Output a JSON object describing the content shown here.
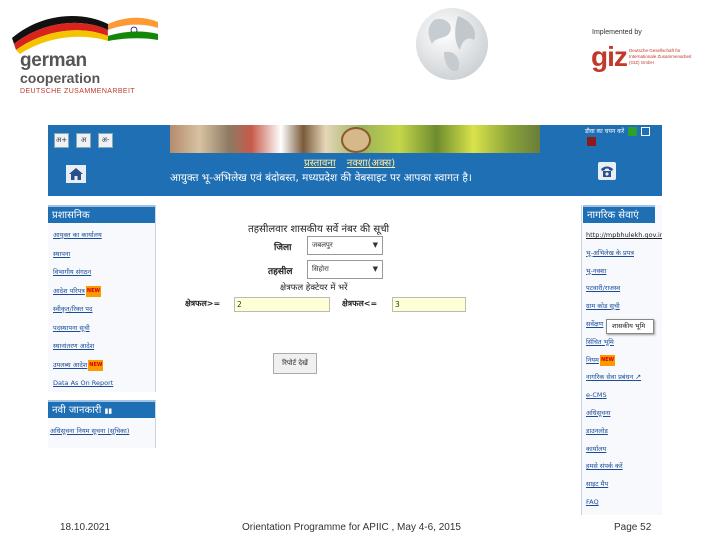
{
  "slide": {
    "logo": {
      "line1": "german",
      "line2": "cooperation",
      "line3": "DEUTSCHE ZUSAMMENARBEIT"
    },
    "implemented_by": "Implemented by",
    "giz": {
      "word": "giz",
      "sub": "Deutsche Gesellschaft für Internationale Zusammenarbeit (GIZ) GmbH"
    },
    "footer": {
      "date": "18.10.2021",
      "title": "Orientation Programme for APIIC , May 4-6, 2015",
      "page": "Page 52"
    }
  },
  "portal": {
    "lang_buttons": [
      "अ+",
      "अ",
      "अ-"
    ],
    "top_links": [
      "प्रस्तावना",
      "नक्शा(अक्स)"
    ],
    "welcome": "आयुक्त भू-अभिलेख एवं बंदोबस्त, मध्यप्रदेश की वेबसाइट पर आपका स्वागत है।",
    "size_label": "डीवा का चयन करें",
    "left_panel": {
      "title": "प्रशासनिक",
      "items": [
        {
          "label": "आयुक्त का कार्यालय",
          "badge": ""
        },
        {
          "label": "स्थापना",
          "badge": ""
        },
        {
          "label": "विभागीय संगठन",
          "badge": ""
        },
        {
          "label": "आदेश परिपत्र",
          "badge": "NEW"
        },
        {
          "label": "स्वीकृत/रिक्त पद",
          "badge": ""
        },
        {
          "label": "पदस्थापना सूची",
          "badge": ""
        },
        {
          "label": "स्थानांतरण आदेश",
          "badge": ""
        },
        {
          "label": "उपलब्ध आदेश",
          "badge": "NEW"
        },
        {
          "label": "Data As On Report",
          "badge": ""
        }
      ]
    },
    "left_panel2": {
      "title": "नवी जानकारी",
      "items": [
        "अधिसूचना नियम सूचना (सूचिका)"
      ]
    },
    "right_panel": {
      "title": "नागरिक सेवाएं",
      "items": [
        {
          "label": "http://mpbhulekh.gov.in",
          "badge": ""
        },
        {
          "label": "भू-अभिलेख के प्रपत्र",
          "badge": ""
        },
        {
          "label": "भू-नक्शा",
          "badge": ""
        },
        {
          "label": "पटवारी/राजस्व",
          "badge": ""
        },
        {
          "label": "ग्राम कोड सूची",
          "badge": ""
        },
        {
          "label": "सर्वेक्षण",
          "badge": ""
        },
        {
          "label": "सिंचित भूमि",
          "badge": ""
        },
        {
          "label": "नियम",
          "badge": "NEW"
        },
        {
          "label": "नागरिक सेवा प्रबंधन",
          "badge": ""
        },
        {
          "label": "e-CMS",
          "badge": ""
        },
        {
          "label": "अधिसूचना",
          "badge": ""
        },
        {
          "label": "डाउनलोड",
          "badge": ""
        },
        {
          "label": "कार्यालय",
          "badge": ""
        },
        {
          "label": "हमसे संपर्क करें",
          "badge": ""
        },
        {
          "label": "साइट मैप",
          "badge": ""
        },
        {
          "label": "FAQ",
          "badge": ""
        }
      ]
    },
    "form": {
      "title": "तहसीलवार शासकीय सर्वे नंबर की सूची",
      "district_label": "जिला",
      "district_value": "जबलपुर",
      "tehsil_label": "तहसील",
      "tehsil_value": "सिहोरा",
      "subtitle": "क्षेत्रफल हेक्टेयर में भरें",
      "area_from_label": "क्षेत्रफल>=",
      "area_from_value": "2",
      "area_to_label": "क्षेत्रफल<=",
      "area_to_value": "3",
      "submit_label": "रिपोर्ट देखें"
    },
    "tooltip": "शासकीय भूमि"
  }
}
